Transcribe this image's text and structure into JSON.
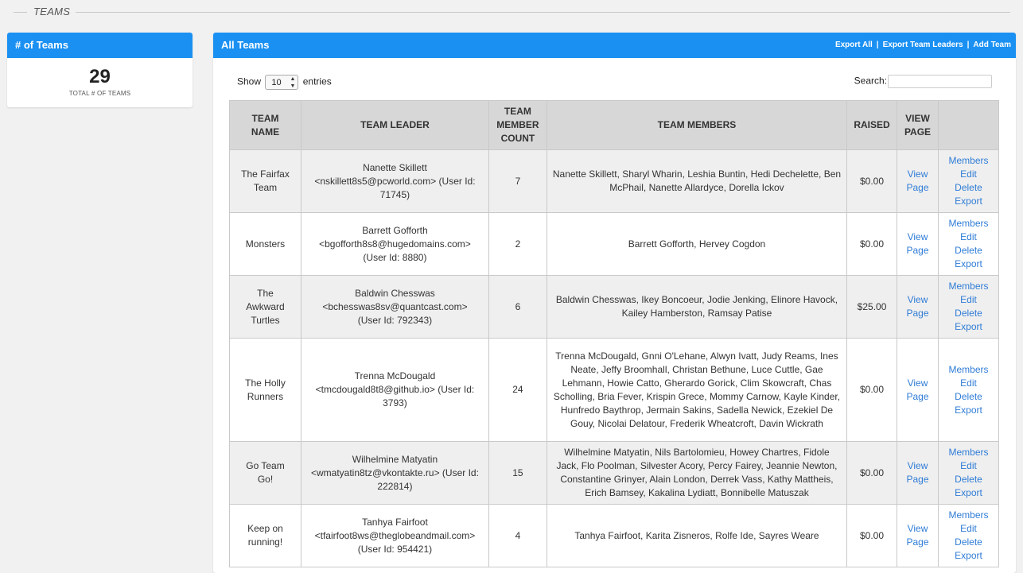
{
  "section": {
    "title": "TEAMS"
  },
  "stats": {
    "header": "# of Teams",
    "value": "29",
    "label": "TOTAL # OF TEAMS"
  },
  "panel": {
    "title": "All Teams",
    "links": [
      "Export All",
      "Export Team Leaders",
      "Add Team"
    ]
  },
  "controls": {
    "show_label": "Show",
    "entries_value": "10",
    "entries_label": "entries",
    "search_label": "Search:",
    "search_value": ""
  },
  "table": {
    "headers": [
      "TEAM NAME",
      "TEAM LEADER",
      "TEAM MEMBER COUNT",
      "TEAM MEMBERS",
      "RAISED",
      "VIEW PAGE",
      ""
    ],
    "view_label": "View Page",
    "actions": [
      "Members",
      "Edit",
      "Delete",
      "Export"
    ],
    "rows": [
      {
        "name": "The Fairfax Team",
        "leader": "Nanette Skillett <nskillett8s5@pcworld.com> (User Id: 71745)",
        "count": "7",
        "members": "Nanette Skillett, Sharyl Wharin, Leshia Buntin, Hedi Dechelette, Ben McPhail, Nanette Allardyce, Dorella Ickov",
        "raised": "$0.00"
      },
      {
        "name": "Monsters",
        "leader": "Barrett Gofforth <bgofforth8s8@hugedomains.com> (User Id: 8880)",
        "count": "2",
        "members": "Barrett Gofforth, Hervey Cogdon",
        "raised": "$0.00"
      },
      {
        "name": "The Awkward Turtles",
        "leader": "Baldwin Chesswas <bchesswas8sv@quantcast.com> (User Id: 792343)",
        "count": "6",
        "members": "Baldwin Chesswas, Ikey Boncoeur, Jodie Jenking, Elinore Havock, Kailey Hamberston, Ramsay Patise",
        "raised": "$25.00"
      },
      {
        "name": "The Holly Runners",
        "leader": "Trenna McDougald <tmcdougald8t8@github.io> (User Id: 3793)",
        "count": "24",
        "members": "Trenna McDougald, Gnni O'Lehane, Alwyn Ivatt, Judy Reams, Ines Neate, Jeffy Broomhall, Christan Bethune, Luce Cuttle, Gae Lehmann, Howie Catto, Gherardo Gorick, Clim Skowcraft, Chas Scholling, Bria Fever, Krispin Grece, Mommy Carnow, Kayle Kinder, Hunfredo Baythrop, Jermain Sakins, Sadella Newick, Ezekiel De Gouy, Nicolai Delatour, Frederik Wheatcroft, Davin Wickrath",
        "raised": "$0.00"
      },
      {
        "name": "Go Team Go!",
        "leader": "Wilhelmine Matyatin <wmatyatin8tz@vkontakte.ru> (User Id: 222814)",
        "count": "15",
        "members": "Wilhelmine Matyatin, Nils Bartolomieu, Howey Chartres, Fidole Jack, Flo Poolman, Silvester Acory, Percy Fairey, Jeannie Newton, Constantine Grinyer, Alain London, Derrek Vass, Kathy Mattheis, Erich Bamsey, Kakalina Lydiatt, Bonnibelle Matuszak",
        "raised": "$0.00"
      },
      {
        "name": "Keep on running!",
        "leader": "Tanhya Fairfoot <tfairfoot8ws@theglobeandmail.com> (User Id: 954421)",
        "count": "4",
        "members": "Tanhya Fairfoot, Karita Zisneros, Rolfe Ide, Sayres Weare",
        "raised": "$0.00"
      }
    ]
  }
}
